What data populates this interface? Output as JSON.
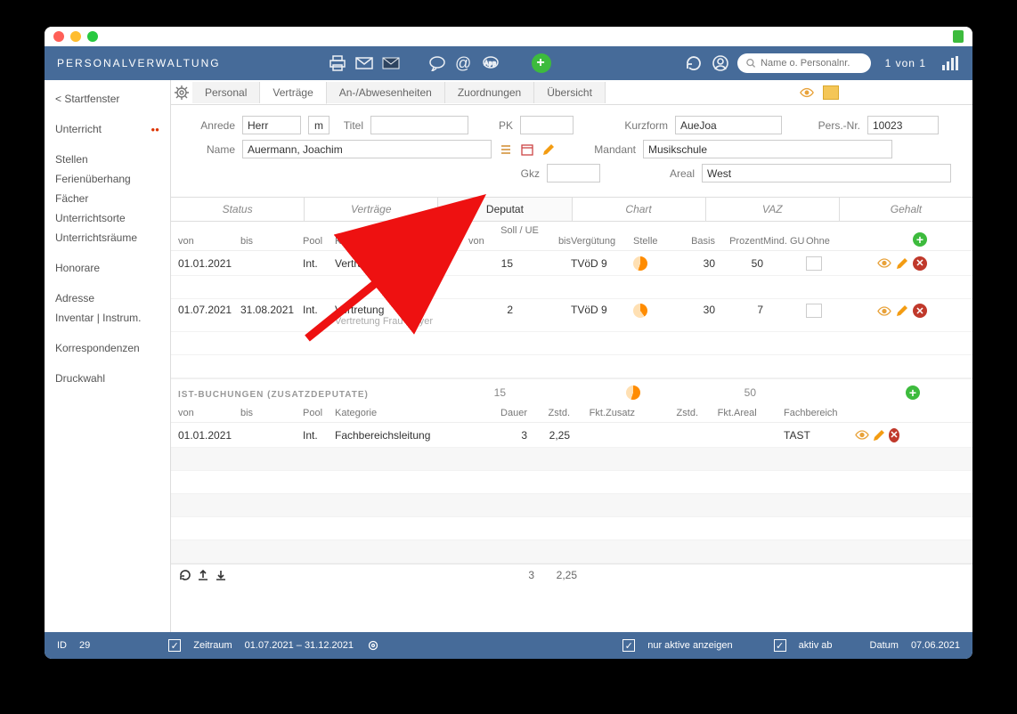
{
  "titlebar": {},
  "header": {
    "title": "PERSONALVERWALTUNG",
    "search_placeholder": "Name o. Personalnr.",
    "counter": "1 von 1"
  },
  "sidebar": {
    "back": "< Startfenster",
    "items": [
      "Unterricht",
      "Stellen",
      "Ferienüberhang",
      "Fächer",
      "Unterrichtsorte",
      "Unterrichtsräume",
      "Honorare",
      "Adresse",
      "Inventar | Instrum.",
      "Korrespondenzen",
      "Druckwahl"
    ]
  },
  "tabs": {
    "items": [
      "Personal",
      "Verträge",
      "An-/Abwesenheiten",
      "Zuordnungen",
      "Übersicht"
    ],
    "active": 1
  },
  "form": {
    "anrede_lbl": "Anrede",
    "anrede": "Herr",
    "anrede2": "m",
    "titel_lbl": "Titel",
    "titel": "",
    "pk_lbl": "PK",
    "pk": "",
    "name_lbl": "Name",
    "name": "Auermann, Joachim",
    "gkz_lbl": "Gkz",
    "gkz": "",
    "kurz_lbl": "Kurzform",
    "kurz": "AueJoa",
    "persnr_lbl": "Pers.-Nr.",
    "persnr": "10023",
    "mandant_lbl": "Mandant",
    "mandant": "Musikschule",
    "areal_lbl": "Areal",
    "areal": "West"
  },
  "subtabs": [
    "Status",
    "Verträge",
    "Deputat",
    "Chart",
    "VAZ",
    "Gehalt"
  ],
  "subtab_active": 2,
  "deputat_head": {
    "von": "von",
    "bis": "bis",
    "pool": "Pool",
    "kat": "Kategorie",
    "soll_ue": "Soll / UE",
    "soll_von": "von",
    "soll_bis": "bis",
    "verg": "Vergütung",
    "stelle": "Stelle",
    "basis": "Basis",
    "prozent": "Prozent",
    "mindgu": "Mind. GU",
    "ohne": "Ohne"
  },
  "deputat_rows": [
    {
      "von": "01.01.2021",
      "bis": "",
      "pool": "Int.",
      "kat": "Vertrag",
      "soll_von": "15",
      "soll_bis": "",
      "verg": "TVöD 9",
      "basis": "30",
      "prozent": "50"
    },
    {
      "von": "01.07.2021",
      "bis": "31.08.2021",
      "pool": "Int.",
      "kat": "Vertretung",
      "note": "Vertretung Frau Meyer",
      "soll_von": "2",
      "soll_bis": "",
      "verg": "TVöD 9",
      "basis": "30",
      "prozent": "7"
    }
  ],
  "ist_section": {
    "title": "IST-BUCHUNGEN (ZUSATZDEPUTATE)",
    "sum_soll": "15",
    "sum_proz": "50",
    "head": {
      "von": "von",
      "bis": "bis",
      "pool": "Pool",
      "kat": "Kategorie",
      "dauer": "Dauer",
      "zstd": "Zstd.",
      "fkt": "Fkt.",
      "zusatz": "Zusatz",
      "zstd2": "Zstd.",
      "fkt2": "Fkt.",
      "areal": "Areal",
      "fb": "Fachbereich"
    },
    "rows": [
      {
        "von": "01.01.2021",
        "bis": "",
        "pool": "Int.",
        "kat": "Fachbereichsleitung",
        "dauer": "3",
        "zstd": "2,25",
        "fb": "TAST"
      }
    ],
    "totals": {
      "dauer": "3",
      "zstd": "2,25"
    }
  },
  "footer": {
    "id_lbl": "ID",
    "id": "29",
    "zeitraum_lbl": "Zeitraum",
    "zeitraum": "01.07.2021 – 31.12.2021",
    "nur_aktive": "nur aktive anzeigen",
    "aktiv_ab": "aktiv ab",
    "datum_lbl": "Datum",
    "datum": "07.06.2021"
  }
}
